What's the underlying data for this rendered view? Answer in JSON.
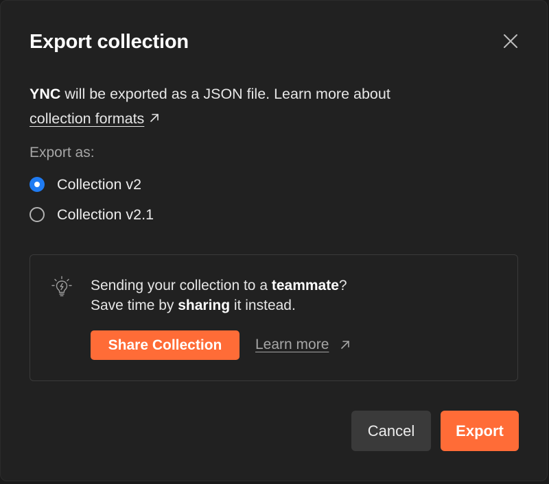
{
  "dialog": {
    "title": "Export collection",
    "close_icon": "close-icon"
  },
  "description": {
    "collection_name": "YNC",
    "text": " will be exported as a JSON file. Learn more about",
    "link_label": "collection formats",
    "link_icon": "external-arrow-icon"
  },
  "export_as": {
    "label": "Export as:",
    "options": [
      {
        "label": "Collection v2",
        "selected": true
      },
      {
        "label": "Collection v2.1",
        "selected": false
      }
    ]
  },
  "tip": {
    "icon": "lightbulb-icon",
    "line1_pre": "Sending your collection to a ",
    "line1_bold": "teammate",
    "line1_post": "?",
    "line2_pre": "Save time by ",
    "line2_bold": "sharing",
    "line2_post": " it instead.",
    "share_button_label": "Share Collection",
    "learn_more_label": "Learn more",
    "learn_more_icon": "external-arrow-icon"
  },
  "footer": {
    "cancel_label": "Cancel",
    "export_label": "Export"
  },
  "colors": {
    "accent": "#ff6c37",
    "radio_selected": "#1f7bf2",
    "background": "#212121"
  }
}
